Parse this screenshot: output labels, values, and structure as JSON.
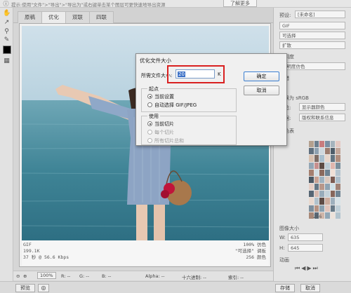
{
  "topbar": {
    "hint": "提示:使用\"文件\">\"导出\">\"导出为\"或右键单击某个图层可更快速地导出资源",
    "more_label": "了解更多"
  },
  "tabs": [
    {
      "label": "原稿"
    },
    {
      "label": "优化"
    },
    {
      "label": "双联"
    },
    {
      "label": "四联"
    }
  ],
  "info": {
    "left": [
      "GIF",
      "199.1K",
      "37 秒 @ 56.6 Kbps"
    ],
    "right": [
      "100% 仿色",
      "\"可选择\" 调板",
      "256 颜色"
    ]
  },
  "statusbar": {
    "zoom": "100%",
    "r": "R: --",
    "g": "G: --",
    "b": "B: --",
    "alpha": "Alpha: --",
    "hex": "十六进制: --",
    "index": "索引: --"
  },
  "bottombar": {
    "preview": "预览",
    "save": "存储",
    "cancel": "取消"
  },
  "right_panel": {
    "preset_label": "预设:",
    "preset_value": "[未命名]",
    "format": "GIF",
    "reduction": "可选择",
    "dither": "扩散",
    "transparency": "透明度",
    "matte": "透明度仿色",
    "interlace": "交错",
    "convert_srgb": "转换为 sRGB",
    "preview_label": "预览:",
    "preview_value": "显示器颜色",
    "metadata_label": "数据:",
    "metadata_value": "版权和联系信息",
    "color_table": "颜色表",
    "count": "256",
    "image_size": "图像大小",
    "w_label": "W:",
    "w_value": "635",
    "h_label": "H:",
    "h_value": "645",
    "anim_label": "动画"
  },
  "dialog": {
    "title": "优化文件大小",
    "field_label": "所需文件大小:",
    "field_value": "20",
    "unit": "K",
    "ok": "确定",
    "cancel": "取消",
    "start_group": "起点",
    "start_options": [
      {
        "label": "当前设置",
        "selected": true
      },
      {
        "label": "自动选择 GIF/JPEG",
        "selected": false
      }
    ],
    "use_group": "使用",
    "use_options": [
      {
        "label": "当前切片",
        "selected": true,
        "enabled": true
      },
      {
        "label": "每个切片",
        "selected": false,
        "enabled": false
      },
      {
        "label": "所有切片总和",
        "selected": false,
        "enabled": false
      }
    ]
  },
  "colors": {
    "highlight": "#d92020",
    "selection": "#3a6fc6"
  },
  "palette_colors": [
    "#b3a08e",
    "#6d7f8e",
    "#c97c7e",
    "#7a8fa3",
    "#a5b3bd",
    "#e4c9c3",
    "#5f6f7e",
    "#8ea1b1",
    "#cfd8de",
    "#9d7c6e",
    "#4e5d6a",
    "#c2a69a",
    "#d9c1b0",
    "#7e6c64",
    "#a9bfce",
    "#e8d6cb",
    "#627482",
    "#b08d7d",
    "#93a6b5",
    "#c78f8d",
    "#5d4b44",
    "#bccbd4",
    "#e0b6ae",
    "#7a8e9c",
    "#a47f70",
    "#d2dde3",
    "#8b6a5e",
    "#6e8292",
    "#f0e0d6",
    "#b6c5cf",
    "#4a5864",
    "#c7a193",
    "#9fb2c0",
    "#dcc8bd",
    "#7c5c52",
    "#acbdc9",
    "#e5cfc6",
    "#657785",
    "#b8978a",
    "#8fa3b2",
    "#cfe0e7",
    "#a08276",
    "#566674",
    "#d6bab0",
    "#98acbb",
    "#c4d2da",
    "#86665b",
    "#708493",
    "#e9d9cf",
    "#b1c2cc",
    "#5e4c46",
    "#cbab9d",
    "#9eb0be",
    "#d8e3e8",
    "#7d8f9d",
    "#b59282",
    "#8aa0af",
    "#e2c4bb",
    "#687a88",
    "#c0d0d9",
    "#a88878",
    "#5a6a78",
    "#d0b6a9",
    "#92a7b6",
    "#ede2da",
    "#b3c4ce"
  ]
}
